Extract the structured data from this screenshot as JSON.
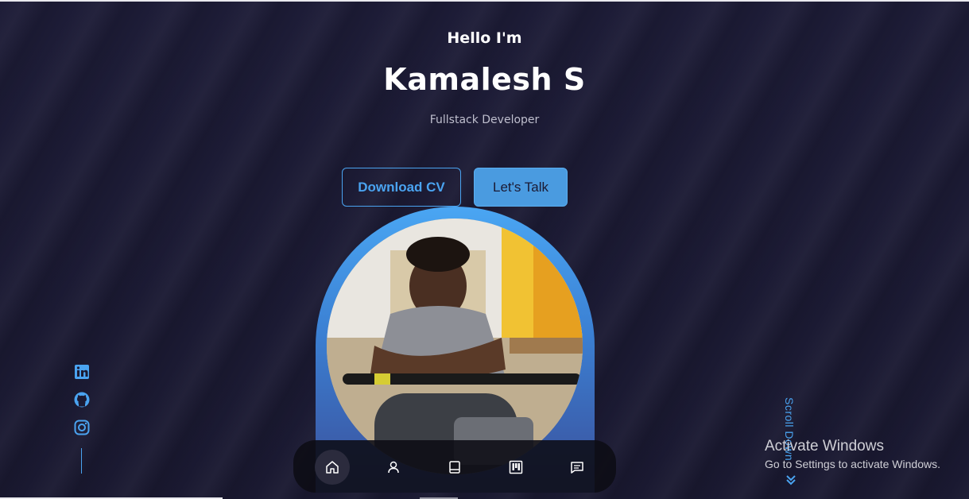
{
  "hero": {
    "greeting": "Hello I'm",
    "name": "Kamalesh S",
    "role": "Fullstack Developer"
  },
  "buttons": {
    "download_cv": "Download CV",
    "lets_talk": "Let's Talk"
  },
  "socials": [
    {
      "icon": "linkedin-icon"
    },
    {
      "icon": "github-icon"
    },
    {
      "icon": "instagram-icon"
    }
  ],
  "scroll": {
    "label": "Scroll Down"
  },
  "nav": [
    {
      "icon": "home-icon",
      "active": true
    },
    {
      "icon": "user-icon",
      "active": false
    },
    {
      "icon": "book-icon",
      "active": false
    },
    {
      "icon": "projects-icon",
      "active": false
    },
    {
      "icon": "message-icon",
      "active": false
    }
  ],
  "watermark": {
    "title": "Activate Windows",
    "subtitle": "Go to Settings to activate Windows."
  },
  "colors": {
    "background": "#1b1a33",
    "accent": "#4aa3f0",
    "button_fill": "#4a9be0"
  }
}
